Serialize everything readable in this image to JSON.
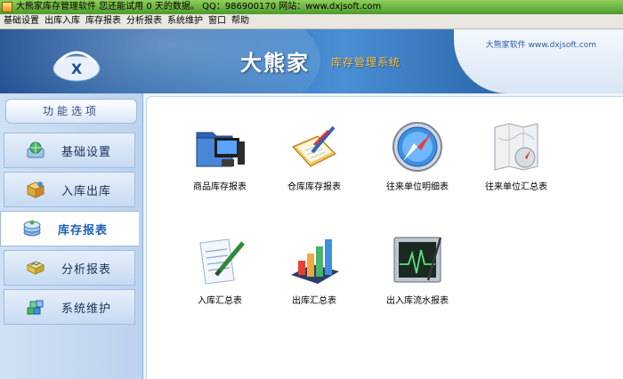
{
  "window": {
    "title": "大熊家库存管理软件   您还能试用 0 天的数据。    QQ：986900170 网站：www.dxjsoft.com"
  },
  "menu": [
    "基础设置",
    "出库入库",
    "库存报表",
    "分析报表",
    "系统维护",
    "窗口",
    "帮助"
  ],
  "banner": {
    "logo_letter": "X",
    "brand": "大熊家",
    "subtitle": "库存管理系统",
    "company": "大熊家软件  www.dxjsoft.com"
  },
  "sidebar": {
    "header": "功能选项",
    "items": [
      {
        "label": "基础设置",
        "icon": "globe-icon",
        "active": false
      },
      {
        "label": "入库出库",
        "icon": "box-icon",
        "active": false
      },
      {
        "label": "库存报表",
        "icon": "stack-icon",
        "active": true
      },
      {
        "label": "分析报表",
        "icon": "chart-icon",
        "active": false
      },
      {
        "label": "系统维护",
        "icon": "blocks-icon",
        "active": false
      }
    ]
  },
  "reports": [
    {
      "label": "商品库存报表",
      "icon": "folder-computer-icon"
    },
    {
      "label": "仓库库存报表",
      "icon": "clipboard-pencil-icon"
    },
    {
      "label": "往来单位明细表",
      "icon": "compass-icon"
    },
    {
      "label": "往来单位汇总表",
      "icon": "map-compass-icon"
    },
    {
      "label": "入库汇总表",
      "icon": "document-pen-icon"
    },
    {
      "label": "出库汇总表",
      "icon": "bar-chart-icon"
    },
    {
      "label": "出入库流水报表",
      "icon": "monitor-pulse-icon"
    }
  ],
  "colors": {
    "accent": "#1f5fb4",
    "banner_blue": "#2f6db3",
    "subtitle_gold": "#f5c14a",
    "titlebar_green": "#6bb543"
  }
}
